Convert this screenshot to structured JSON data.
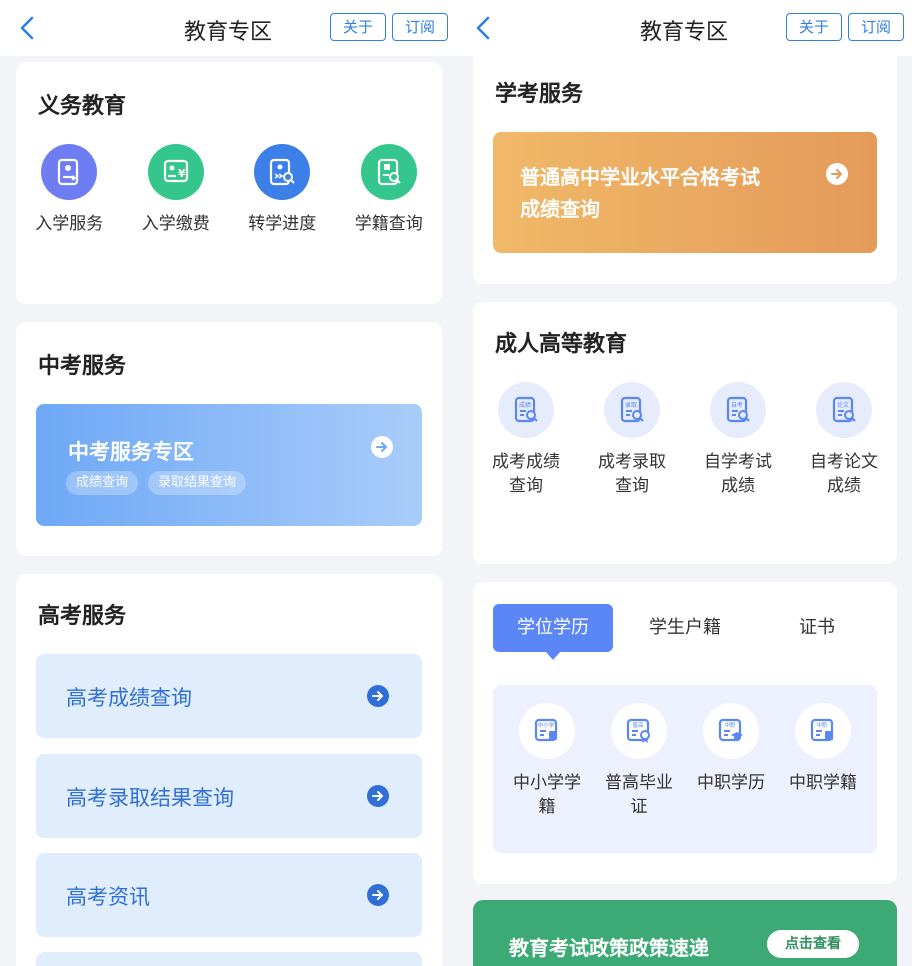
{
  "left": {
    "nav": {
      "title": "教育专区",
      "about_label": "关于",
      "subscribe_label": "订阅"
    },
    "compulsory": {
      "title": "义务教育",
      "items": [
        {
          "label": "入学服务",
          "icon": "enrollment-icon",
          "color": "#6f7df2"
        },
        {
          "label": "入学缴费",
          "icon": "payment-icon",
          "color": "#34c68c"
        },
        {
          "label": "转学进度",
          "icon": "transfer-progress-icon",
          "color": "#3d7fe8"
        },
        {
          "label": "学籍查询",
          "icon": "record-search-icon",
          "color": "#34c68c"
        }
      ]
    },
    "zhongkao": {
      "title": "中考服务",
      "banner_title": "中考服务专区",
      "tags": [
        "成绩查询",
        "录取结果查询"
      ]
    },
    "gaokao": {
      "title": "高考服务",
      "rows": [
        "高考成绩查询",
        "高考录取结果查询",
        "高考资讯"
      ]
    }
  },
  "right": {
    "nav": {
      "title": "教育专区",
      "about_label": "关于",
      "subscribe_label": "订阅"
    },
    "xuekao": {
      "title": "学考服务",
      "banner_line1": "普通高中学业水平合格考试",
      "banner_line2": "成绩查询"
    },
    "adult": {
      "title": "成人高等教育",
      "items": [
        {
          "line1": "成考成绩",
          "line2": "查询",
          "badge": "成绩"
        },
        {
          "line1": "成考录取",
          "line2": "查询",
          "badge": "录取"
        },
        {
          "line1": "自学考试",
          "line2": "成绩",
          "badge": "自考"
        },
        {
          "line1": "自考论文",
          "line2": "成绩",
          "badge": "论文"
        }
      ]
    },
    "tabs": {
      "labels": [
        "学位学历",
        "学生户籍",
        "证书"
      ],
      "active": "学位学历",
      "items": [
        {
          "line1": "中小学学",
          "line2": "籍",
          "badge": "中小学"
        },
        {
          "line1": "普高毕业",
          "line2": "证",
          "badge": "普高"
        },
        {
          "line1": "中职学历",
          "line2": "",
          "badge": "中职"
        },
        {
          "line1": "中职学籍",
          "line2": "",
          "badge": "中职"
        }
      ]
    },
    "policy": {
      "title": "教育考试政策政策速递",
      "button": "点击查看"
    }
  },
  "colors": {
    "accent": "#2f7fe6",
    "zhongkao_banner_from": "#6ea8f6",
    "zhongkao_banner_to": "#a9cdfa",
    "xuekao_banner_from": "#f0b968",
    "xuekao_banner_to": "#e59a5a",
    "policy_banner": "#3daa76",
    "tab_active": "#5b86f5"
  }
}
